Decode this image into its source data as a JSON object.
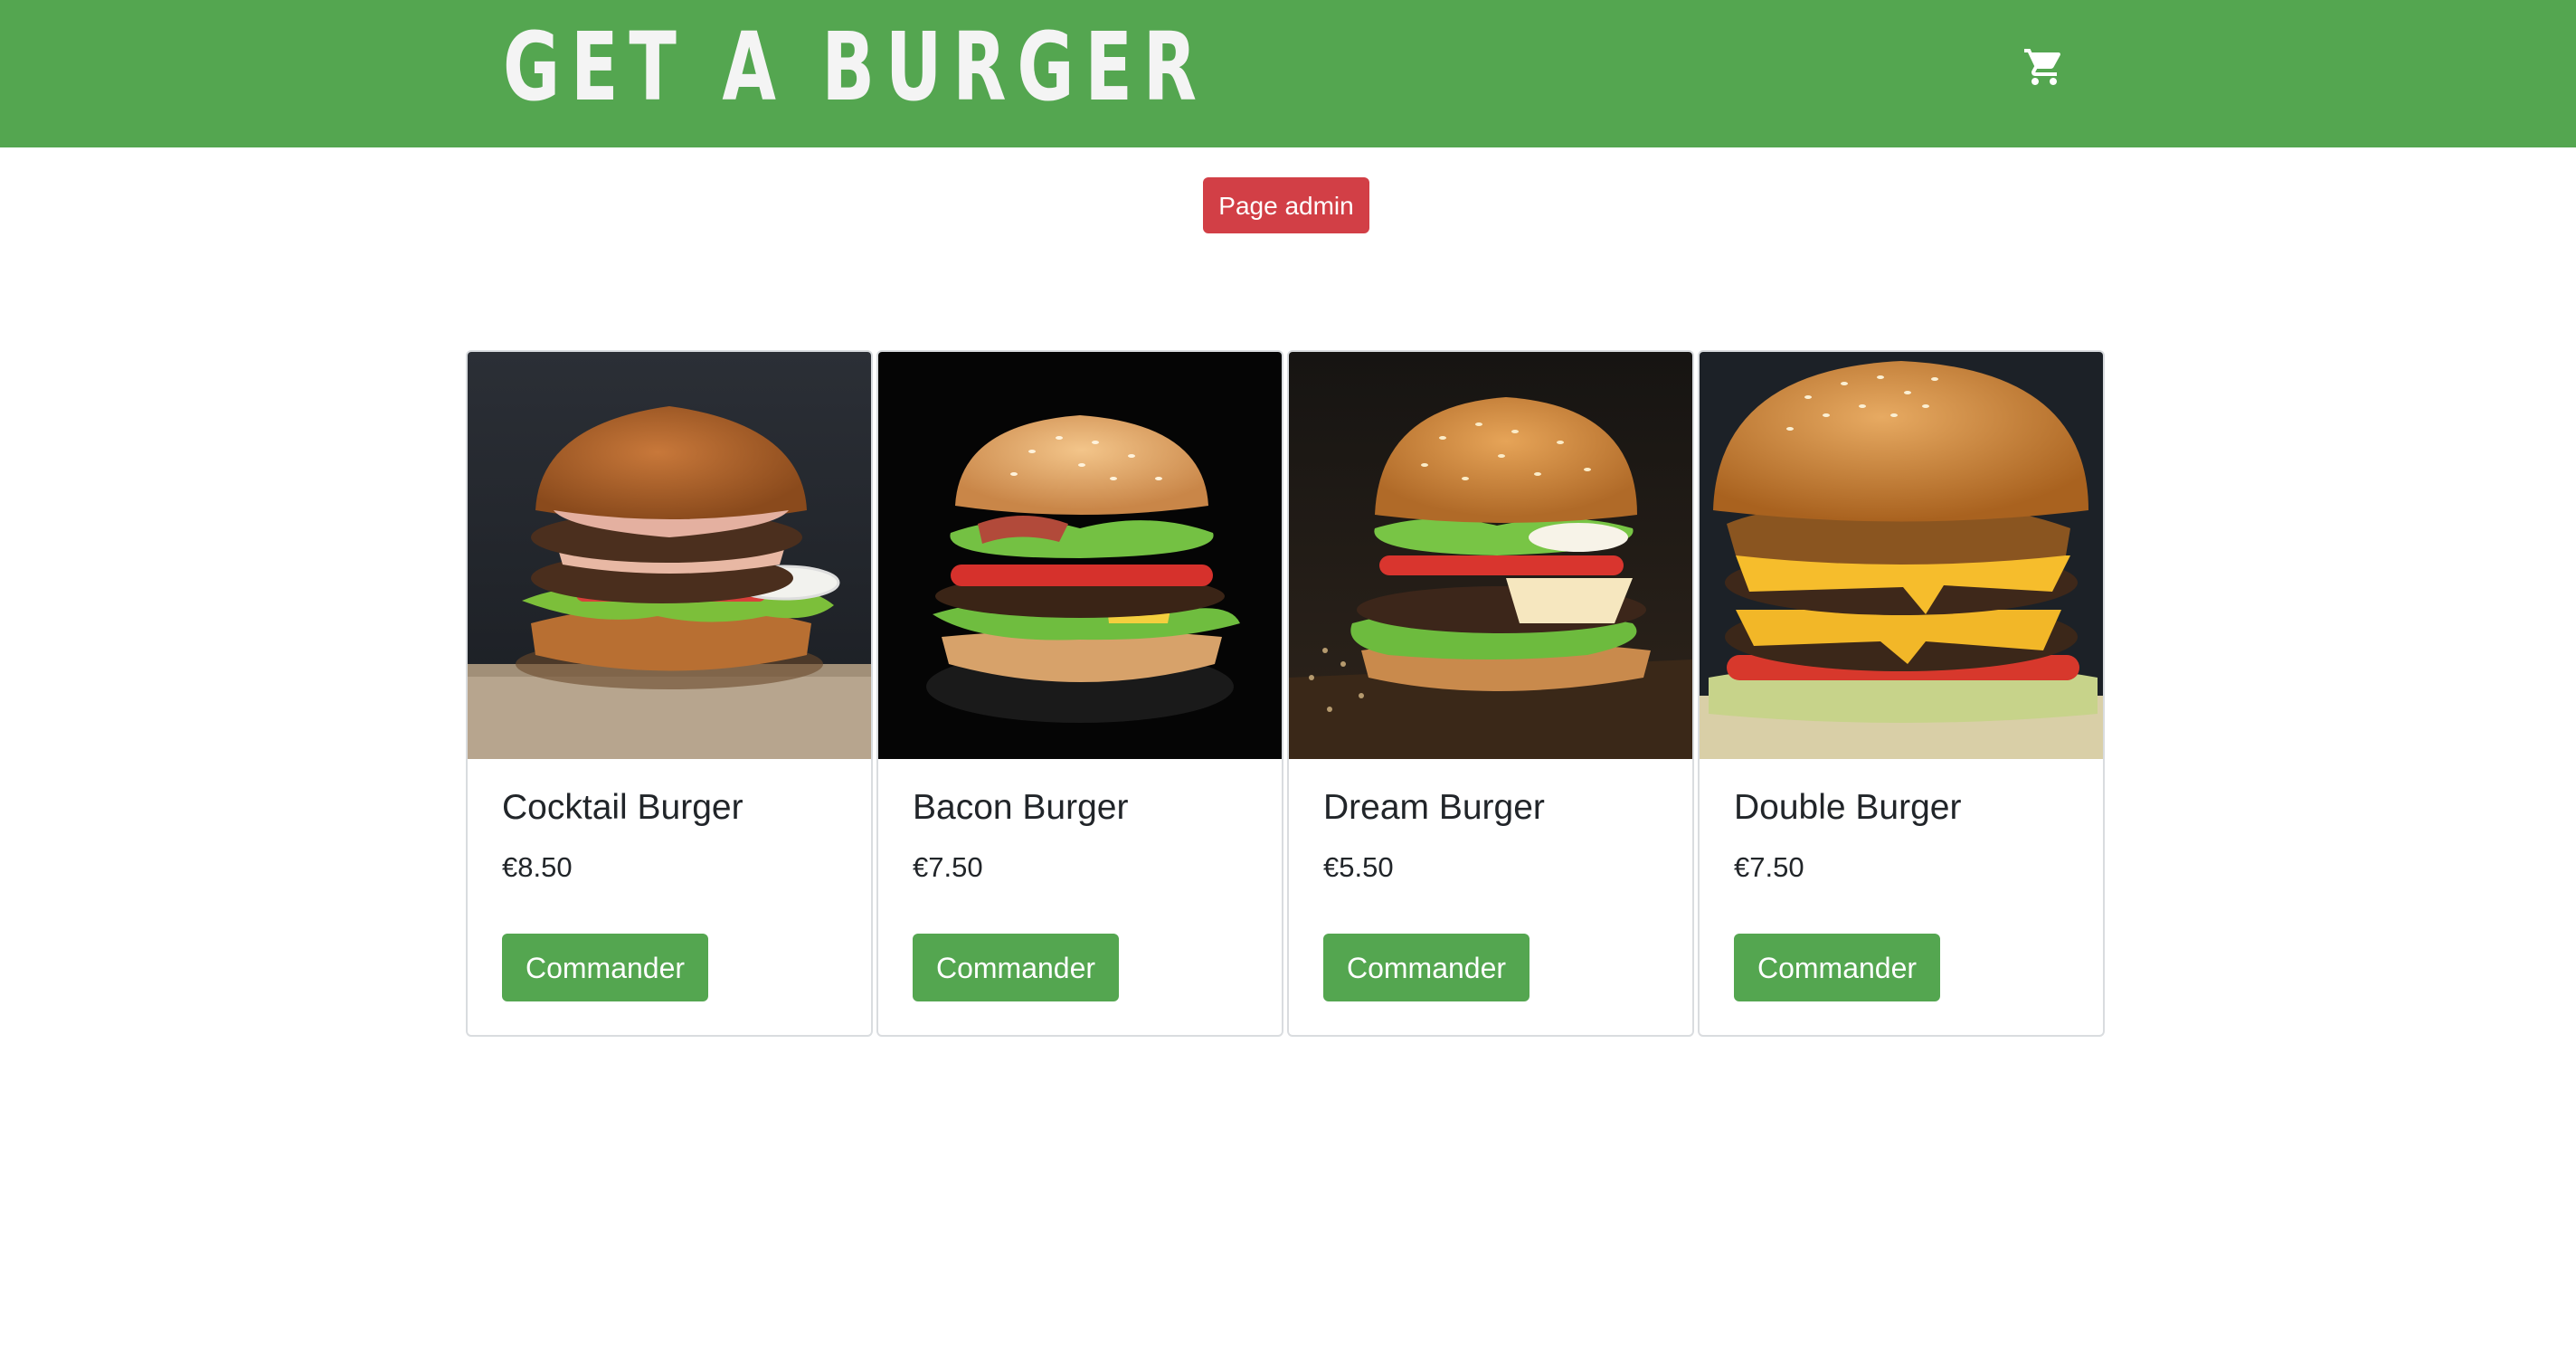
{
  "header": {
    "brand": "GET A BURGER",
    "cart_icon": "shopping-cart-icon",
    "background_color": "#54a650"
  },
  "admin_button": {
    "label": "Page admin",
    "color": "#d23f46"
  },
  "products": [
    {
      "name": "Cocktail Burger",
      "price": "€8.50",
      "button_label": "Commander"
    },
    {
      "name": "Bacon Burger",
      "price": "€7.50",
      "button_label": "Commander"
    },
    {
      "name": "Dream Burger",
      "price": "€5.50",
      "button_label": "Commander"
    },
    {
      "name": "Double Burger",
      "price": "€7.50",
      "button_label": "Commander"
    }
  ],
  "accent_color": "#54a650"
}
